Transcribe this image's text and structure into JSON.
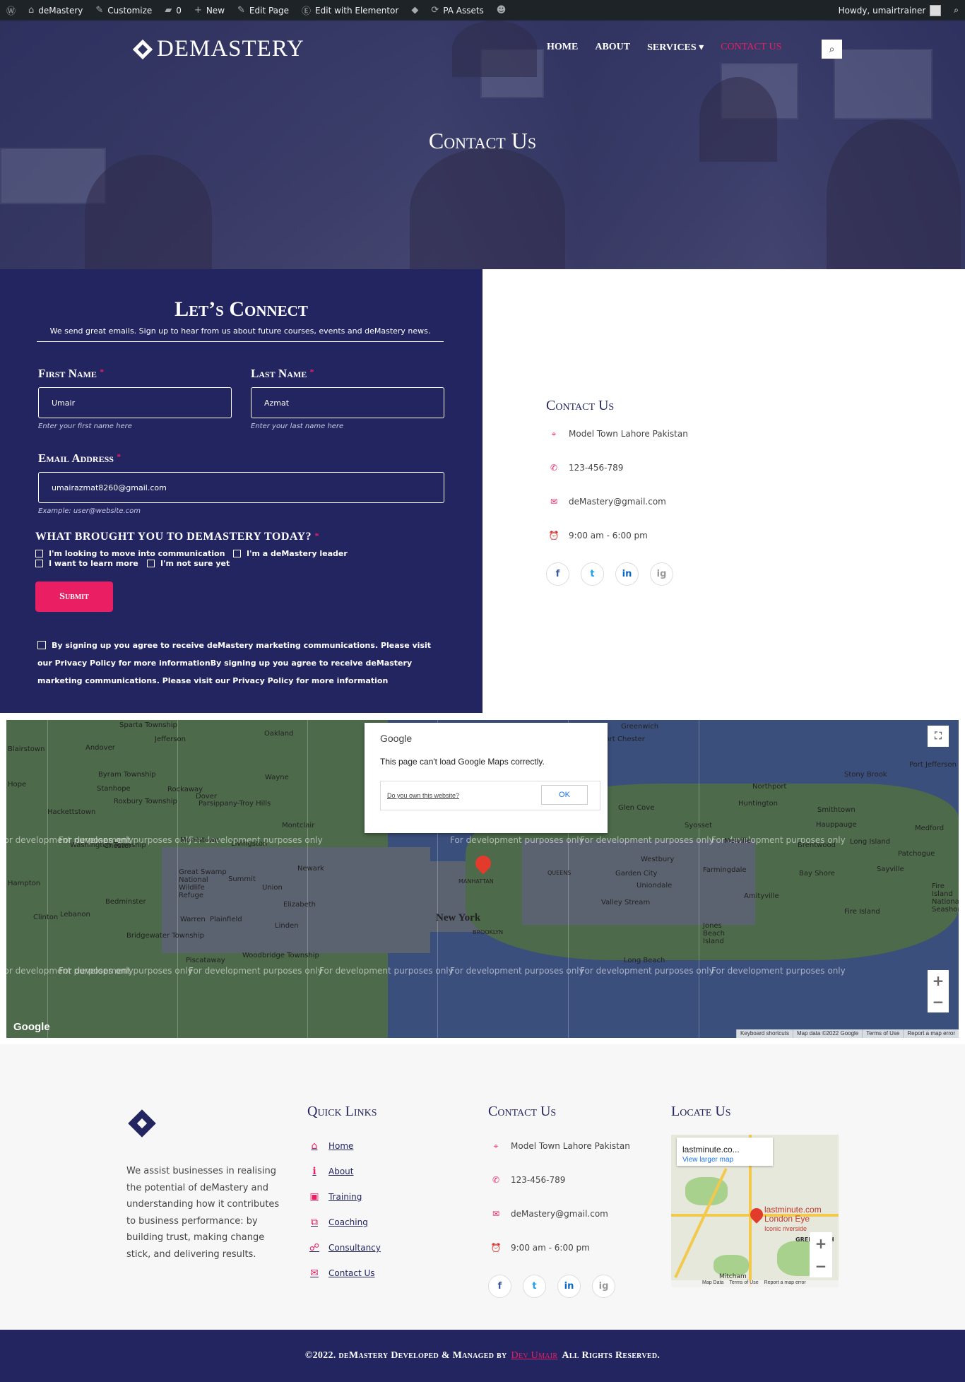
{
  "adminbar": {
    "site": "deMastery",
    "customize": "Customize",
    "comments": "0",
    "new": "New",
    "edit_page": "Edit Page",
    "edit_elementor": "Edit with Elementor",
    "pa_assets": "PA Assets",
    "howdy": "Howdy, umairtrainer"
  },
  "header": {
    "logo": "DEMASTERY",
    "nav": [
      "HOME",
      "ABOUT",
      "SERVICES",
      "CONTACT US"
    ],
    "hero_title": "Contact Us"
  },
  "form": {
    "title": "Let’s Connect",
    "subtitle": "We send great emails. Sign up to hear from us about future courses, events and deMastery news.",
    "first_name_label": "First Name",
    "first_name_value": "Umair",
    "first_name_hint": "Enter your first name here",
    "last_name_label": "Last Name",
    "last_name_value": "Azmat",
    "last_name_hint": "Enter your last name here",
    "email_label": "Email Address",
    "email_value": "umairazmat8260@gmail.com",
    "email_hint": "Example: user@website.com",
    "required_mark": "*",
    "question": "WHAT BROUGHT YOU TO DEMASTERY TODAY?",
    "options": [
      "I'm looking to move into communication",
      "I'm a deMastery leader",
      "I want to learn more",
      "I'm not sure yet"
    ],
    "submit": "Submit",
    "consent": "By signing up you agree to receive deMastery marketing communications. Please visit our Privacy Policy for more informationBy signing up you agree to receive deMastery marketing communications. Please visit our Privacy Policy for more information"
  },
  "contact": {
    "title": "Contact Us",
    "address": "Model Town Lahore Pakistan",
    "phone": "123-456-789",
    "email": "deMastery@gmail.com",
    "hours": "9:00 am - 6:00 pm",
    "socials": [
      "f",
      "t",
      "in",
      "ig"
    ]
  },
  "map": {
    "dialog_brand": "Google",
    "dialog_message": "This page can't load Google Maps correctly.",
    "dialog_link": "Do you own this website?",
    "dialog_ok": "OK",
    "watermark": "For development purposes only",
    "city": "New York",
    "places": [
      "Sparta Township",
      "Jefferson",
      "Oakland",
      "Andover",
      "Byram Township",
      "Stanhope",
      "Rockaway",
      "Dover",
      "Parsippany-Troy Hills",
      "Wayne",
      "Roxbury Township",
      "Hackettstown",
      "Washington Township",
      "Chester",
      "Morristown",
      "Livingston",
      "Montclair",
      "Newark",
      "Elizabeth",
      "Bedminster",
      "Warren",
      "Plainfield",
      "Linden",
      "Bridgewater Township",
      "Piscataway",
      "Woodbridge Township",
      "Great Swamp National Wildlife Refuge",
      "Summit",
      "Union",
      "MANHATTAN",
      "QUEENS",
      "BROOKLYN",
      "Glen Cove",
      "Huntington",
      "Northport",
      "Smithtown",
      "Hauppauge",
      "Brentwood",
      "Long Island",
      "Sayville",
      "Patchogue",
      "Medford",
      "Port Jefferson",
      "Stony Brook",
      "Melville",
      "Syosset",
      "Westbury",
      "Garden City",
      "Farmingdale",
      "Uniondale",
      "Bay Shore",
      "Amityville",
      "Valley Stream",
      "Long Beach",
      "Jones Beach Island",
      "Fire Island",
      "Fire Island National Seashore",
      "Greenwich",
      "Port Chester",
      "Hope",
      "Blairstown",
      "Clinton",
      "Lebanon",
      "Hampton"
    ],
    "google": "Google",
    "attribution": [
      "Keyboard shortcuts",
      "Map data ©2022 Google",
      "Terms of Use",
      "Report a map error"
    ]
  },
  "footer": {
    "about": "We assist businesses in realising the potential of deMastery and understanding how it contributes to business performance: by building trust, making change stick, and delivering results.",
    "quick_links_title": "Quick Links",
    "quick_links": [
      "Home",
      "About",
      "Training",
      "Coaching",
      "Consultancy",
      "Contact Us"
    ],
    "contact_title": "Contact Us",
    "address": "Model Town Lahore Pakistan",
    "phone": "123-456-789",
    "email": "deMastery@gmail.com",
    "hours": "9:00 am - 6:00 pm",
    "locate_title": "Locate Us",
    "map_card_title": "lastminute.co...",
    "map_card_link": "View larger map",
    "map_pin_label": "lastminute.com London Eye",
    "map_pin_sub": "Iconic riverside",
    "map_area": "GREENWICH",
    "map_mitcham": "Mitcham",
    "map_attrib": [
      "Map Data",
      "Terms of Use",
      "Report a map error"
    ],
    "copyright_pre": "©2022. deMastery Developed & Managed by",
    "copyright_dev": "Dev Umair",
    "copyright_post": "All Rights Reserved."
  },
  "colors": {
    "navy": "#232560",
    "accent": "#e91e63"
  }
}
